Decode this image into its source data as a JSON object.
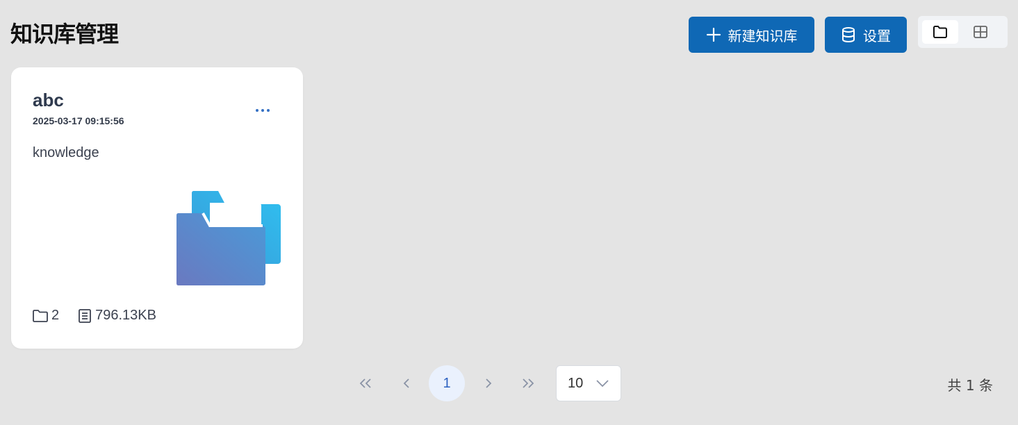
{
  "header": {
    "title": "知识库管理",
    "new_button": "新建知识库",
    "settings_button": "设置",
    "view_options": [
      {
        "icon": "folder-icon",
        "active": true
      },
      {
        "icon": "grid-icon",
        "active": false
      }
    ]
  },
  "cards": [
    {
      "title": "abc",
      "date": "2025-03-17 09:15:56",
      "description": "knowledge",
      "folder_count": "2",
      "size": "796.13KB"
    }
  ],
  "pagination": {
    "current_page": "1",
    "page_size": "10",
    "total": "共 1 条"
  },
  "colors": {
    "primary": "#0f68b5",
    "page_bg": "#e4e4e4",
    "accent_blue": "#3470c4"
  }
}
